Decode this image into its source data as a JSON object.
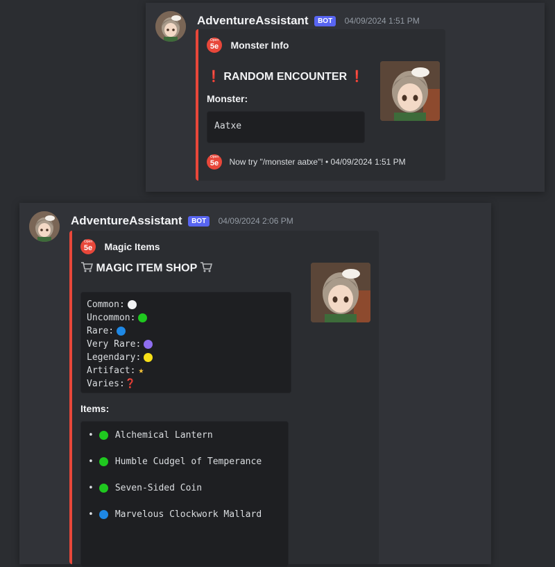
{
  "message1": {
    "username": "AdventureAssistant",
    "bot_tag": "BOT",
    "timestamp": "04/09/2024 1:51 PM",
    "embed": {
      "author_icon_small": "Open",
      "author_icon_big": "5e",
      "author": "Monster Info",
      "title_prefix": "❗",
      "title": "RANDOM ENCOUNTER",
      "title_suffix": "❗",
      "field_name": "Monster:",
      "field_value": "Aatxe",
      "footer": "Now try \"/monster aatxe\"! • 04/09/2024 1:51 PM"
    }
  },
  "message2": {
    "username": "AdventureAssistant",
    "bot_tag": "BOT",
    "timestamp": "04/09/2024 2:06 PM",
    "embed": {
      "author_icon_small": "Open",
      "author_icon_big": "5e",
      "author": "Magic Items",
      "title": "MAGIC ITEM SHOP",
      "key": [
        {
          "label": "Common:",
          "icon": "white-circle",
          "color": "#f2f3f5"
        },
        {
          "label": "Uncommon:",
          "icon": "green-circle",
          "color": "#1fc81f"
        },
        {
          "label": "Rare:",
          "icon": "blue-circle",
          "color": "#1e88e5"
        },
        {
          "label": "Very Rare:",
          "icon": "purple-circle",
          "color": "#8f6ef0"
        },
        {
          "label": "Legendary:",
          "icon": "yellow-circle",
          "color": "#f7e018"
        },
        {
          "label": "Artifact:",
          "icon": "star",
          "glyph": "★"
        },
        {
          "label": "Varies:",
          "icon": "question-mark",
          "glyph": "❓"
        }
      ],
      "items_label": "Items:",
      "items": [
        {
          "bullet": "•",
          "name": "Alchemical Lantern",
          "rarity": "uncommon"
        },
        {
          "bullet": "•",
          "name": "Humble Cudgel of Temperance",
          "rarity": "uncommon"
        },
        {
          "bullet": "•",
          "name": "Seven-Sided Coin",
          "rarity": "uncommon"
        },
        {
          "bullet": "•",
          "name": "Marvelous Clockwork Mallard",
          "rarity": "rare"
        }
      ]
    }
  },
  "colors": {
    "embed_accent": "#e8473a",
    "bot_tag": "#5865f2",
    "background": "#313338"
  }
}
